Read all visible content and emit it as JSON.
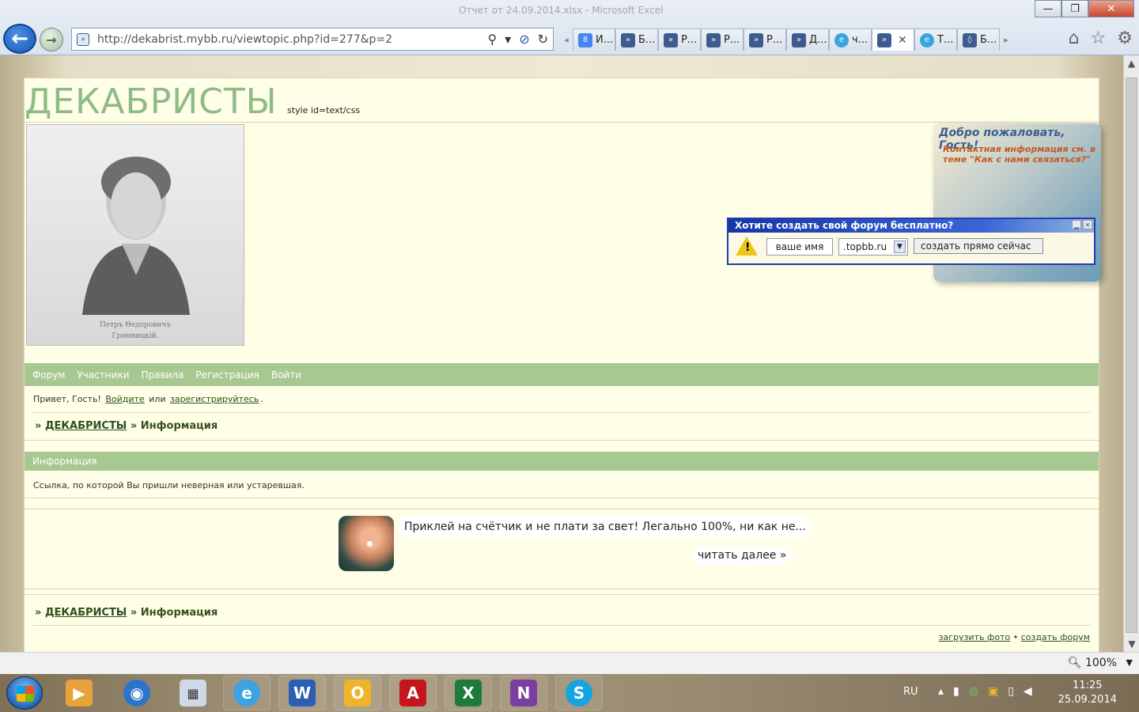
{
  "window": {
    "title": "Отчет от 24.09.2014.xlsx - Microsoft Excel"
  },
  "browser": {
    "url": "http://dekabrist.mybb.ru/viewtopic.php?id=277&p=2",
    "tabs": [
      {
        "label": "И...",
        "icon": "8"
      },
      {
        "label": "Б...",
        "icon": "»"
      },
      {
        "label": "Р...",
        "icon": "»"
      },
      {
        "label": "Р...",
        "icon": "»"
      },
      {
        "label": "Р...",
        "icon": "»"
      },
      {
        "label": "Д...",
        "icon": "»"
      },
      {
        "label": "ч...",
        "icon": "e"
      },
      {
        "label": "",
        "icon": "»"
      },
      {
        "label": "Т...",
        "icon": "e"
      },
      {
        "label": "Б...",
        "icon": "◊"
      }
    ],
    "close_tab": "✕",
    "zoom": "100%"
  },
  "forum": {
    "logo": "ДЕКАБРИСТЫ",
    "style_note": "style id=text/css",
    "portrait_caption_1": "Петръ Θедоровичъ",
    "portrait_caption_2": "Громницкій.",
    "menu": [
      "Форум",
      "Участники",
      "Правила",
      "Регистрация",
      "Войти"
    ],
    "greeting_prefix": "Привет, Гость!",
    "login_link": "Войдите",
    "or_text": "или",
    "register_link": "зарегистрируйтесь",
    "greeting_suffix": ".",
    "crumb_sep": "»",
    "crumb_home": "ДЕКАБРИСТЫ",
    "crumb_current": "Информация",
    "info_title": "Информация",
    "info_message": "Ссылка, по которой Вы пришли неверная или устаревшая.",
    "ad_text": "Приклей на счётчик и не плати за свет! Легально 100%, ни как не...",
    "ad_more": "читать далее »",
    "footer_upload": "загрузить фото",
    "footer_dot": "•",
    "footer_create": "создать форум"
  },
  "welcome": {
    "title": "Добро пожаловать, Гость!",
    "subtitle": "Контактная информация см. в теме \"Как с нами связаться?\""
  },
  "popup": {
    "title": "Хотите создать свой форум бесплатно?",
    "name_value": "ваше имя",
    "domain_value": ".topbb.ru",
    "create_label": "создать прямо сейчас"
  },
  "taskbar": {
    "lang": "RU",
    "time": "11:25",
    "date": "25.09.2014"
  },
  "colors": {
    "menu_green": "#a8c891",
    "logo_green": "#8ebb85",
    "page_bg": "#fffee6"
  }
}
